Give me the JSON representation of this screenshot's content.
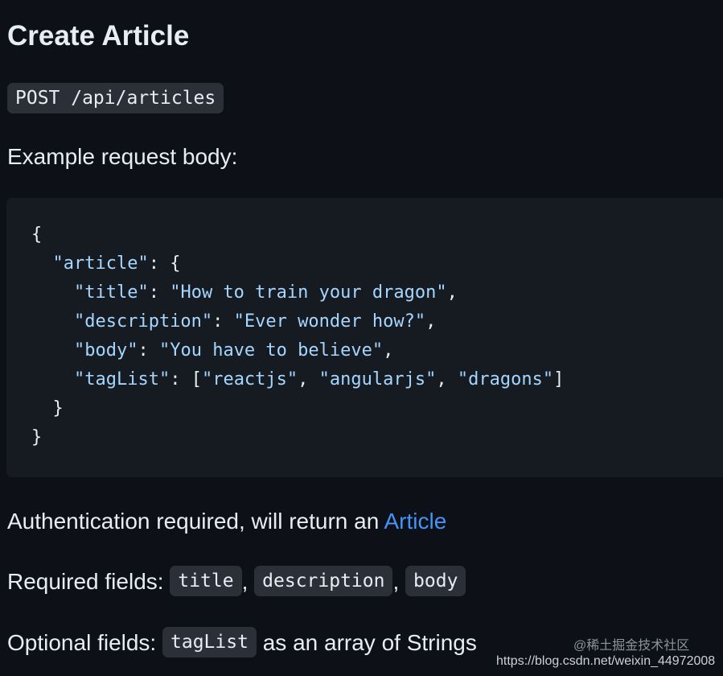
{
  "page": {
    "title": "Create Article",
    "endpoint": "POST /api/articles",
    "example_label": "Example request body:",
    "code_lines": [
      "{",
      "  \"article\": {",
      "    \"title\": \"How to train your dragon\",",
      "    \"description\": \"Ever wonder how?\",",
      "    \"body\": \"You have to believe\",",
      "    \"tagList\": [\"reactjs\", \"angularjs\", \"dragons\"]",
      "  }",
      "}"
    ],
    "auth_text": "Authentication required, will return an ",
    "auth_link": "Article",
    "required_label": "Required fields: ",
    "required_fields": [
      "title",
      "description",
      "body"
    ],
    "field_separator": ", ",
    "optional_label": "Optional fields: ",
    "optional_field": "tagList",
    "optional_suffix": " as an array of Strings"
  },
  "watermark": {
    "brand": "@稀土掘金技术社区",
    "url": "https://blog.csdn.net/weixin_44972008"
  },
  "colors": {
    "background": "#0d1117",
    "code_background": "#161b22",
    "inline_code_background": "#2b3038",
    "text": "#e6edf3",
    "link": "#4493f8"
  }
}
